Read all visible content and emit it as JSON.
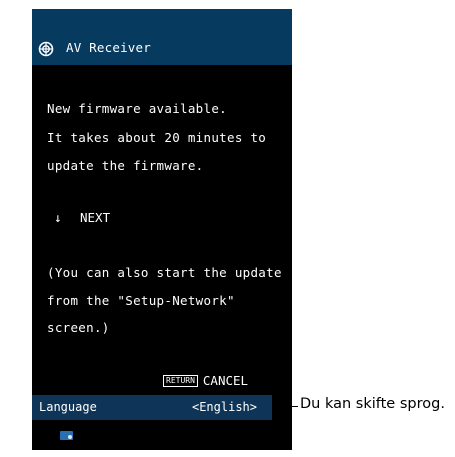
{
  "header": {
    "icon": "globe-icon",
    "title": "AV Receiver"
  },
  "message": {
    "lines": [
      "New firmware available.",
      "It takes about 20 minutes to",
      "update the firmware."
    ]
  },
  "next": {
    "arrow": "↓",
    "label": "NEXT"
  },
  "note": {
    "lines": [
      "(You can also start the update",
      "from the \"Setup-Network\"",
      "screen.)"
    ]
  },
  "cancel": {
    "key_label": "RETURN",
    "label": "CANCEL"
  },
  "language": {
    "label": "Language",
    "value": "<English>"
  },
  "status_icon": "network-icon",
  "callout": {
    "text": "Du kan skifte sprog."
  },
  "colors": {
    "title_bar": "#063a5e",
    "language_bar": "#0e3557",
    "screen_background": "#000000"
  }
}
